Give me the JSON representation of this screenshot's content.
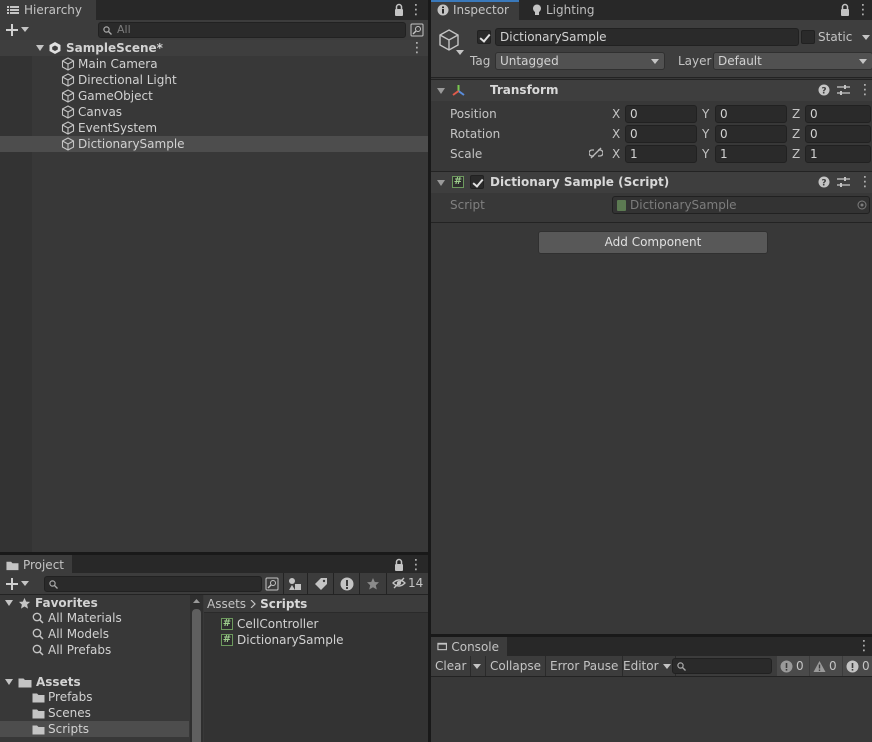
{
  "hierarchy": {
    "tab_label": "Hierarchy",
    "search_placeholder": "All",
    "scene_name": "SampleScene*",
    "items": [
      "Main Camera",
      "Directional Light",
      "GameObject",
      "Canvas",
      "EventSystem",
      "DictionarySample"
    ],
    "selected_item": "DictionarySample"
  },
  "inspector": {
    "tab_label": "Inspector",
    "lighting_tab_label": "Lighting",
    "object_name": "DictionarySample",
    "active": true,
    "static_label": "Static",
    "tag_label": "Tag",
    "tag_value": "Untagged",
    "layer_label": "Layer",
    "layer_value": "Default",
    "transform": {
      "title": "Transform",
      "position_label": "Position",
      "rotation_label": "Rotation",
      "scale_label": "Scale",
      "x_label": "X",
      "y_label": "Y",
      "z_label": "Z",
      "position": {
        "x": "0",
        "y": "0",
        "z": "0"
      },
      "rotation": {
        "x": "0",
        "y": "0",
        "z": "0"
      },
      "scale": {
        "x": "1",
        "y": "1",
        "z": "1"
      }
    },
    "script_component": {
      "title": "Dictionary Sample (Script)",
      "enabled": true,
      "script_label": "Script",
      "script_value": "DictionarySample"
    },
    "add_component_label": "Add Component"
  },
  "project": {
    "tab_label": "Project",
    "hidden_count": "14",
    "favorites_label": "Favorites",
    "favorites": [
      "All Materials",
      "All Models",
      "All Prefabs"
    ],
    "assets_label": "Assets",
    "asset_folders": [
      "Prefabs",
      "Scenes",
      "Scripts"
    ],
    "selected_folder": "Scripts",
    "breadcrumb_root": "Assets",
    "breadcrumb_current": "Scripts",
    "files": [
      "CellController",
      "DictionarySample"
    ]
  },
  "console": {
    "tab_label": "Console",
    "clear_label": "Clear",
    "collapse_label": "Collapse",
    "error_pause_label": "Error Pause",
    "editor_label": "Editor",
    "log_count": "0",
    "warning_count": "0",
    "error_count": "0"
  },
  "colors": {
    "panel_bg": "#383838",
    "selection": "#4d4d4d",
    "accent": "#3a79bb"
  }
}
